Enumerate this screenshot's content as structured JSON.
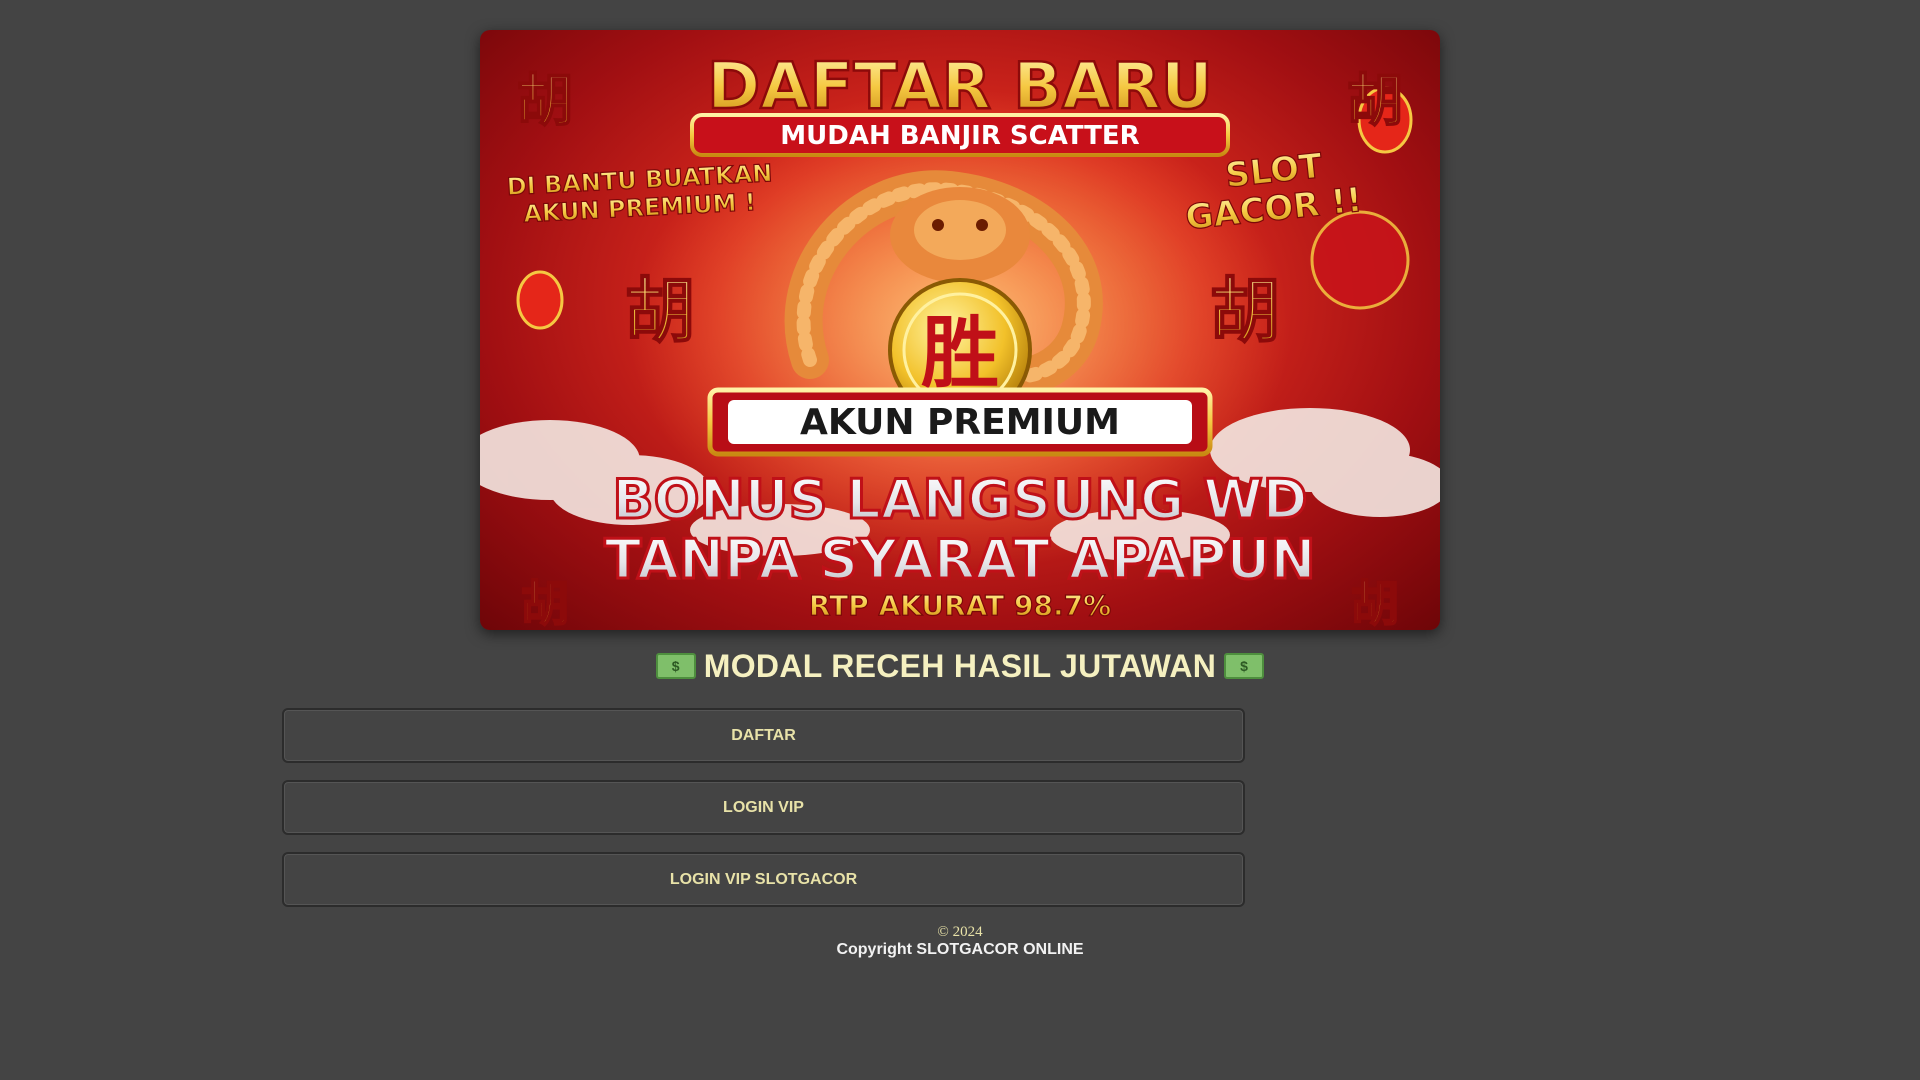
{
  "banner": {
    "title": "DAFTAR BARU",
    "ribbon": "MUDAH BANJIR SCATTER",
    "left_note_line1": "DI BANTU BUATKAN",
    "left_note_line2": "AKUN PREMIUM !",
    "right_note_line1": "SLOT",
    "right_note_line2": "GACOR !!",
    "center_emblem": "胜",
    "corner_glyph": "胡",
    "plaque": "AKUN PREMIUM",
    "bonus_line1": "BONUS LANGSUNG WD",
    "bonus_line2": "TANPA SYARAT APAPUN",
    "rtp": "RTP AKURAT 98.7%"
  },
  "headline": {
    "text": "MODAL RECEH HASIL JUTAWAN",
    "icon": "money-banknote-icon"
  },
  "buttons": [
    {
      "label": "DAFTAR"
    },
    {
      "label": "LOGIN VIP"
    },
    {
      "label": "LOGIN VIP SLOTGACOR"
    }
  ],
  "footer": {
    "year": "© 2024",
    "copyright": "Copyright SLOTGACOR ONLINE"
  },
  "colors": {
    "background": "#444444",
    "button_text": "#e8e2a8",
    "headline_text": "#f5f0c0",
    "banner_red": "#d92a1e",
    "banner_gold": "#f5c842"
  }
}
